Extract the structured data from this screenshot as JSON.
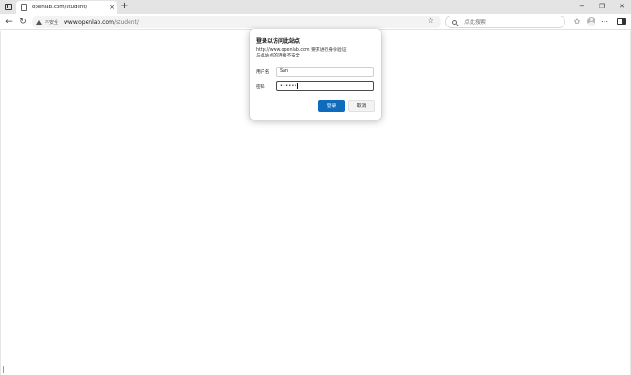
{
  "tab": {
    "title": "openlab.com/student/",
    "close_glyph": "×"
  },
  "window_controls": {
    "minimize": "−",
    "restore": "❐",
    "close": "✕"
  },
  "toolbar": {
    "back": "←",
    "reload": "↻",
    "security_label": "不安全",
    "url_host": "www.openlab.com",
    "url_path": "/student/",
    "favorite_glyph": "☆",
    "collections_glyph": "✩",
    "more_glyph": "⋯"
  },
  "search": {
    "placeholder": "点此搜索"
  },
  "dialog": {
    "title": "登录以访问此站点",
    "message": "http://www.openlab.com 要求进行身份验证\n与此站点的连接不安全",
    "username_label": "用户名",
    "username_value": "San",
    "password_label": "密码",
    "password_value": "••••••",
    "login_button": "登录",
    "cancel_button": "取消"
  },
  "colors": {
    "accent": "#0f6cbd",
    "tabstrip": "#e4e4e4",
    "addressbar": "#f3f3f3"
  }
}
